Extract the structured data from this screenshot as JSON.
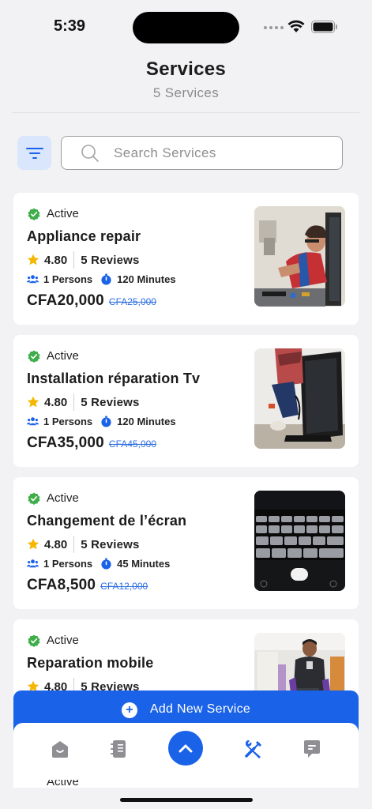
{
  "status_bar": {
    "time": "5:39"
  },
  "header": {
    "title": "Services",
    "subtitle": "5 Services"
  },
  "search": {
    "placeholder": "Search Services",
    "value": ""
  },
  "colors": {
    "accent": "#1a62e8",
    "active_green": "#3fae4a",
    "star": "#f5b700",
    "old_price": "#2f6fe0"
  },
  "services": [
    {
      "status": "Active",
      "title": "Appliance repair",
      "rating": "4.80",
      "reviews": "5 Reviews",
      "persons": "1 Persons",
      "duration": "120 Minutes",
      "price": "CFA20,000",
      "old_price": "CFA25,000",
      "image": "technician-repairing-appliance"
    },
    {
      "status": "Active",
      "title": "Installation réparation Tv",
      "rating": "4.80",
      "reviews": "5 Reviews",
      "persons": "1 Persons",
      "duration": "120 Minutes",
      "price": "CFA35,000",
      "old_price": "CFA45,000",
      "image": "technician-installing-tv"
    },
    {
      "status": "Active",
      "title": "Changement de l’écran",
      "rating": "4.80",
      "reviews": "5 Reviews",
      "persons": "1 Persons",
      "duration": "45 Minutes",
      "price": "CFA8,500",
      "old_price": "CFA12,000",
      "image": "laptop-keyboard-closeup"
    },
    {
      "status": "Active",
      "title": "Reparation mobile",
      "rating": "4.80",
      "reviews": "5 Reviews",
      "image": "technician-in-office"
    }
  ],
  "peek_card": {
    "status": "Active"
  },
  "add_button": {
    "label": "Add New Service"
  },
  "bottom_nav": {
    "items": [
      "home-icon",
      "notebook-icon",
      "chevron-up-icon",
      "tools-icon",
      "chat-icon"
    ]
  }
}
